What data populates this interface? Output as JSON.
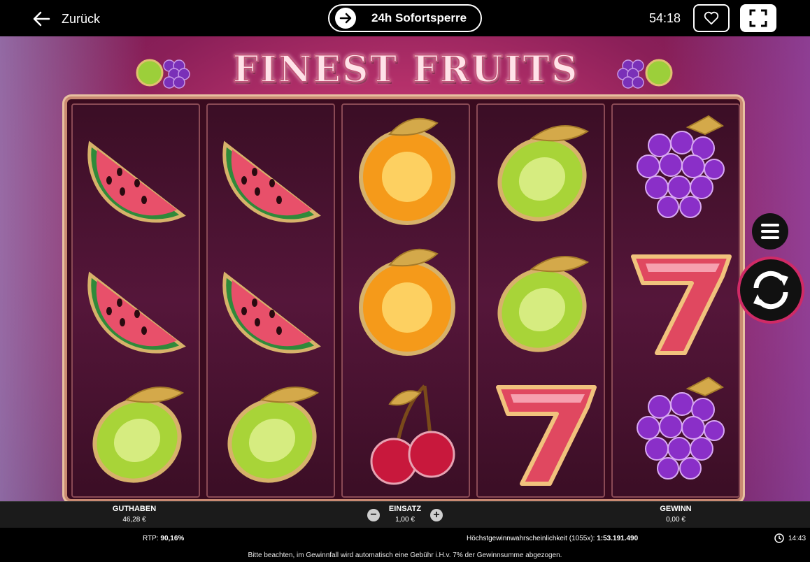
{
  "topbar": {
    "back_label": "Zurück",
    "block_label": "24h Sofortsperre",
    "timer": "54:18"
  },
  "game": {
    "title": "FINEST FRUITS",
    "reels": [
      [
        "watermelon",
        "watermelon",
        "lime"
      ],
      [
        "watermelon",
        "watermelon",
        "lime"
      ],
      [
        "orange",
        "orange",
        "cherry"
      ],
      [
        "lime",
        "lime",
        "seven"
      ],
      [
        "grapes",
        "seven",
        "grapes"
      ]
    ]
  },
  "panel": {
    "balance_label": "GUTHABEN",
    "balance_value": "46,28 €",
    "bet_label": "EINSATZ",
    "bet_value": "1,00 €",
    "win_label": "GEWINN",
    "win_value": "0,00 €"
  },
  "info": {
    "rtp_label": "RTP:",
    "rtp_value": "90,16%",
    "prob_label": "Höchstgewinnwahrscheinlichkeit (1055x):",
    "prob_value": "1:53.191.490",
    "time": "14:43",
    "notice": "Bitte beachten, im Gewinnfall wird automatisch eine Gebühr i.H.v. 7% der Gewinnsumme abgezogen."
  },
  "colors": {
    "accent": "#d02a66",
    "watermelon": "#e8506a",
    "lime": "#a8d438",
    "orange": "#f59a1a",
    "grapes": "#8a2fc8",
    "seven": "#e04860",
    "cherry": "#c8183c"
  }
}
